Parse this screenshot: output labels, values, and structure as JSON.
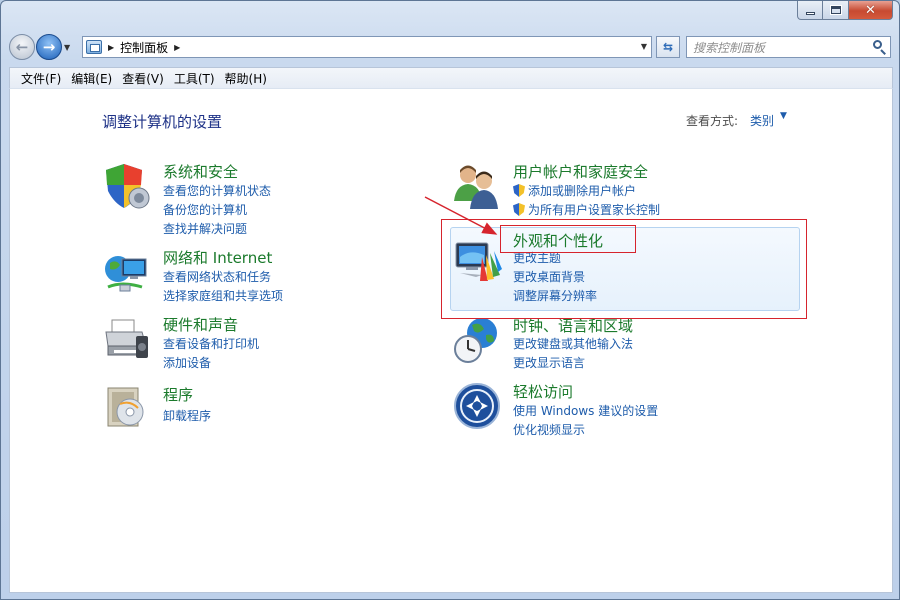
{
  "window": {
    "title": "控制面板"
  },
  "nav": {
    "breadcrumb": [
      "控制面板"
    ],
    "search_placeholder": "搜索控制面板"
  },
  "menu": [
    "文件(F)",
    "编辑(E)",
    "查看(V)",
    "工具(T)",
    "帮助(H)"
  ],
  "content": {
    "heading": "调整计算机的设置",
    "view_by_label": "查看方式:",
    "view_by_value": "类别"
  },
  "categories": [
    {
      "title": "系统和安全",
      "icon": "shield-icon",
      "links": [
        "查看您的计算机状态",
        "备份您的计算机",
        "查找并解决问题"
      ]
    },
    {
      "title": "网络和 Internet",
      "icon": "network-icon",
      "links": [
        "查看网络状态和任务",
        "选择家庭组和共享选项"
      ]
    },
    {
      "title": "硬件和声音",
      "icon": "printer-icon",
      "links": [
        "查看设备和打印机",
        "添加设备"
      ]
    },
    {
      "title": "程序",
      "icon": "programs-icon",
      "links": [
        "卸载程序"
      ]
    },
    {
      "title": "用户帐户和家庭安全",
      "icon": "users-icon",
      "links": [
        "添加或删除用户帐户",
        "为所有用户设置家长控制"
      ]
    },
    {
      "title": "外观和个性化",
      "icon": "display-icon",
      "links": [
        "更改主题",
        "更改桌面背景",
        "调整屏幕分辨率"
      ]
    },
    {
      "title": "时钟、语言和区域",
      "icon": "clock-globe-icon",
      "links": [
        "更改键盘或其他输入法",
        "更改显示语言"
      ]
    },
    {
      "title": "轻松访问",
      "icon": "ease-of-access-icon",
      "links": [
        "使用 Windows 建议的设置",
        "优化视频显示"
      ]
    }
  ],
  "colors": {
    "category_title": "#1b7a2c",
    "link": "#1e5cab",
    "heading": "#1e3287",
    "annotation": "#d6242d"
  }
}
